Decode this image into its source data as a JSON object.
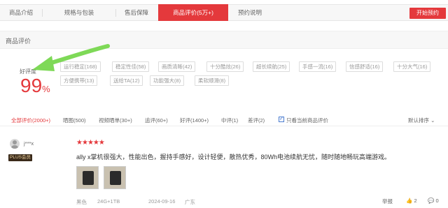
{
  "tabs": [
    {
      "label": "商品介绍"
    },
    {
      "label": "规格与包装"
    },
    {
      "label": "售后保障"
    },
    {
      "label": "商品评价(5万+)"
    },
    {
      "label": "预约说明"
    }
  ],
  "buy_button": "开始预约",
  "section_title": "商品评价",
  "good_rate": {
    "label": "好评度",
    "value": "99",
    "unit": "%"
  },
  "tags": [
    "运行稳定(168)",
    "稳定性佳(58)",
    "画质清晰(42)",
    "十分酷炫(26)",
    "超长续航(25)",
    "手感一流(16)",
    "信感舒适(16)",
    "十分大气(16)",
    "方便携带(13)",
    "送给TA(12)",
    "功能强大(8)",
    "柔软顺滑(8)"
  ],
  "filters": {
    "all": "全部评价(2000+)",
    "photo": "晒图(500)",
    "video": "视频晒单(30+)",
    "followup": "追评(60+)",
    "good": "好评(1400+)",
    "medium": "中评(1)",
    "bad": "差评(2)",
    "only_current": "只看当前商品评价",
    "sort": "默认排序"
  },
  "review": {
    "username": "j***x",
    "member_badge": "PLUS会员",
    "stars": 5,
    "text": "ally x掌机很强大，性能出色，握持手感好，设计轻便，散热优秀，80Wh电池续航无忧，随时随地畅玩高端游戏。",
    "color": "黑色",
    "spec": "24G+1TB",
    "date": "2024-09-16",
    "location": "广东",
    "report": "举报",
    "likes": "2",
    "comments": "0"
  },
  "colors": {
    "accent": "#e4393c",
    "arrow": "#7ed957"
  }
}
